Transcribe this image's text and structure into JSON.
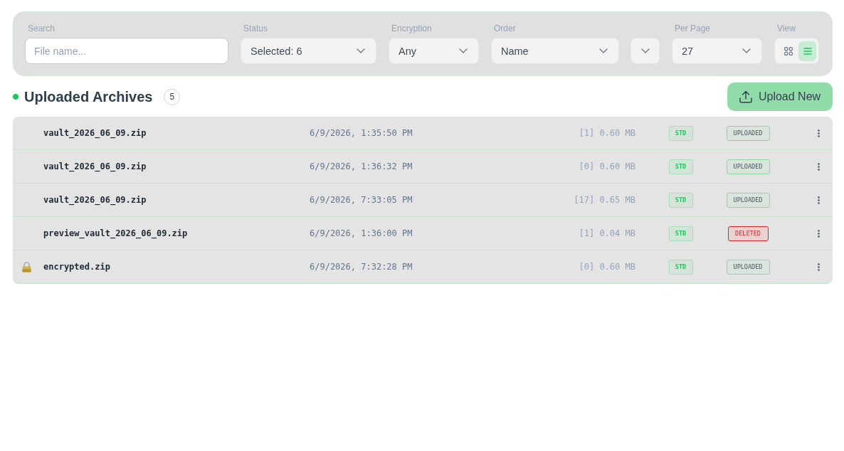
{
  "filters": [
    {
      "kind": "text",
      "label": "Search",
      "placeholder": "File name..."
    },
    {
      "kind": "select",
      "label": "Status",
      "value": "Selected: 6"
    },
    {
      "kind": "select",
      "label": "Encryption",
      "value": "Any"
    },
    {
      "kind": "select",
      "label": "Order",
      "value": "Name"
    },
    {
      "kind": "select"
    },
    {
      "kind": "select",
      "label": "Per Page",
      "value": "27"
    },
    {
      "kind": "view",
      "label": "View",
      "modes": [
        {
          "kind": "grid",
          "selected": false
        },
        {
          "kind": "list",
          "selected": true
        }
      ]
    }
  ],
  "section": {
    "title": "Uploaded Archives",
    "count": "5",
    "action": "Upload New"
  },
  "archives": [
    {
      "kind": "uploaded",
      "locked": false,
      "name": "vault_2026_06_09.zip",
      "date": "6/9/2026, 1:35:50 PM",
      "size": "[1] 0.60 MB",
      "type": "STD",
      "status": "UPLOADED"
    },
    {
      "kind": "uploaded",
      "locked": false,
      "name": "vault_2026_06_09.zip",
      "date": "6/9/2026, 1:36:32 PM",
      "size": "[0] 0.60 MB",
      "type": "STD",
      "status": "UPLOADED"
    },
    {
      "kind": "uploaded",
      "locked": false,
      "name": "vault_2026_06_09.zip",
      "date": "6/9/2026, 7:33:05 PM",
      "size": "[17] 0.65 MB",
      "type": "STD",
      "status": "UPLOADED"
    },
    {
      "kind": "deleted",
      "locked": false,
      "name": "preview_vault_2026_06_09.zip",
      "date": "6/9/2026, 1:36:00 PM",
      "size": "[1] 0.04 MB",
      "type": "STD",
      "status": "DELETED"
    },
    {
      "kind": "uploaded",
      "locked": true,
      "name": "encrypted.zip",
      "date": "6/9/2026, 7:32:28 PM",
      "size": "[0] 0.60 MB",
      "type": "STD",
      "status": "UPLOADED"
    }
  ]
}
